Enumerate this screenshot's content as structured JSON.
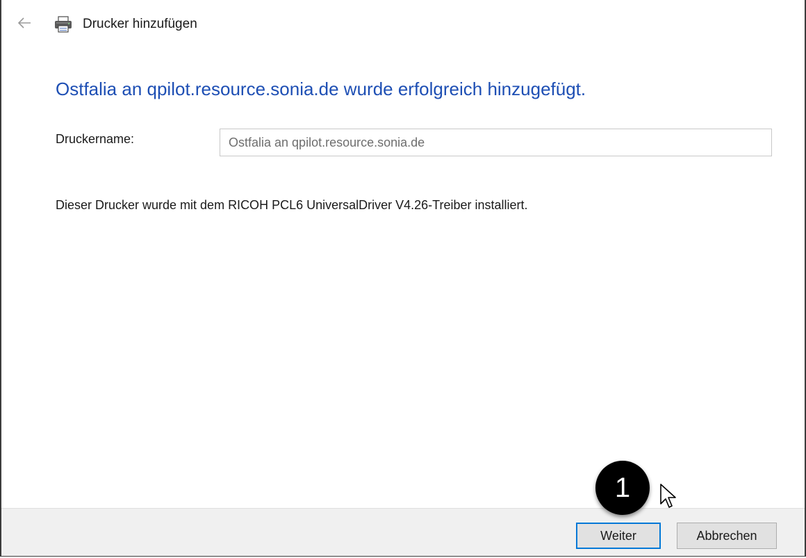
{
  "window": {
    "title": "Drucker hinzufügen",
    "back_icon": "back-arrow-icon",
    "app_icon": "printer-icon"
  },
  "content": {
    "headline": "Ostfalia an qpilot.resource.sonia.de wurde erfolgreich hinzugefügt.",
    "printer_name_label": "Druckername:",
    "printer_name_value": "Ostfalia an qpilot.resource.sonia.de",
    "driver_info": "Dieser Drucker wurde mit dem RICOH PCL6 UniversalDriver V4.26-Treiber installiert."
  },
  "footer": {
    "next_label": "Weiter",
    "cancel_label": "Abbrechen"
  },
  "annotation": {
    "step_number": "1",
    "cursor_icon": "mouse-pointer-icon"
  },
  "colors": {
    "headline": "#1e4fb4",
    "default_button_border": "#0078d7",
    "footer_background": "#f0f0f0",
    "badge": "#000000"
  }
}
